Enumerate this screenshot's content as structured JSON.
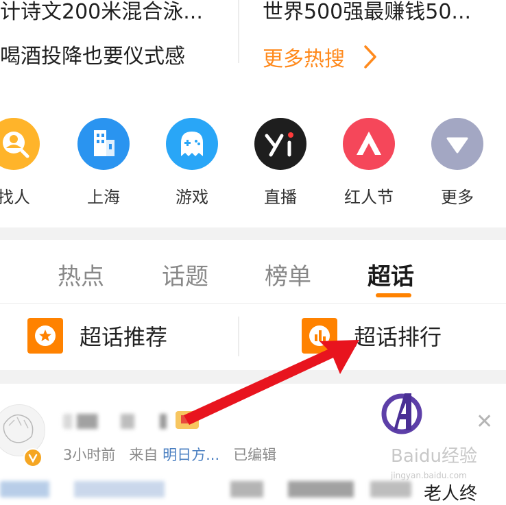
{
  "hot_search": {
    "left_row1": "计诗文200米混合泳...",
    "right_row1": "世界500强最赚钱50...",
    "left_row2": "喝酒投降也要仪式感",
    "more_label": "更多热搜",
    "more_icon": "chevron-right-icon"
  },
  "quick_links": [
    {
      "label": "找人",
      "icon": "find-person-icon",
      "color": "#ffb42a"
    },
    {
      "label": "上海",
      "icon": "city-building-icon",
      "color": "#2a94f0"
    },
    {
      "label": "游戏",
      "icon": "game-ghost-icon",
      "color": "#29a6f7"
    },
    {
      "label": "直播",
      "icon": "yizhibo-live-icon",
      "color": "#1e1e1e"
    },
    {
      "label": "红人节",
      "icon": "hongren-a-icon",
      "color": "#f5475a"
    },
    {
      "label": "更多",
      "icon": "triangle-down-icon",
      "color": "#a3a7c3"
    }
  ],
  "tabs": [
    {
      "label": "热点"
    },
    {
      "label": "话题"
    },
    {
      "label": "榜单"
    },
    {
      "label": "超话",
      "active": true
    }
  ],
  "super_topic": {
    "recommend_label": "超话推荐",
    "ranking_label": "超话排行"
  },
  "post": {
    "time": "3小时前",
    "from": "来自",
    "source": "明日方...",
    "edited": "已编辑",
    "tail_text": "老人终"
  },
  "watermark": {
    "text": "Baidu经验",
    "url": "jingyan.baidu.com"
  },
  "colors": {
    "accent": "#ff8200",
    "arrow": "#e8141e",
    "link": "#4a7fc1"
  }
}
